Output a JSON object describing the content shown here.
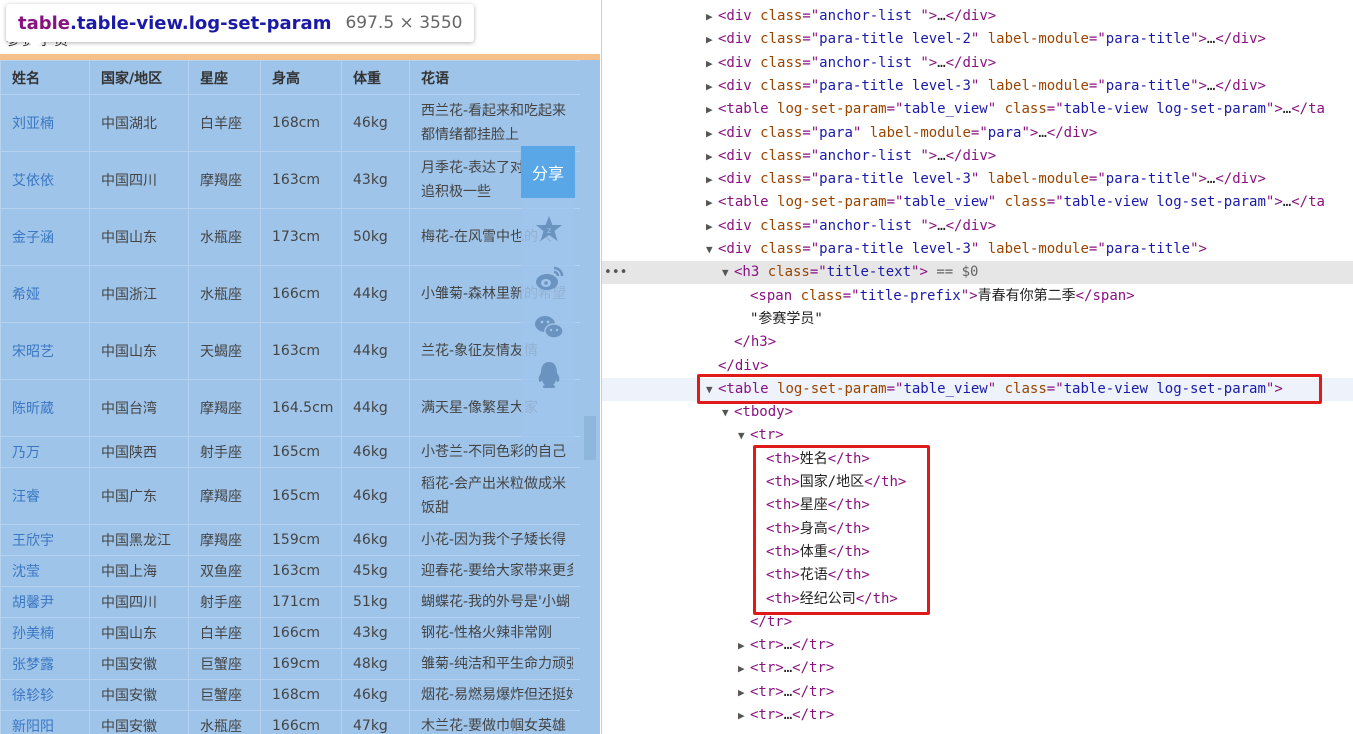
{
  "tooltip": {
    "tag": "table",
    "classes": ".table-view.log-set-param",
    "dimensions": "697.5 × 3550"
  },
  "page_ghost_text": "参赛学员",
  "table": {
    "headers": [
      "姓名",
      "国家/地区",
      "星座",
      "身高",
      "体重",
      "花语"
    ],
    "rows": [
      {
        "name": "刘亚楠",
        "region": "中国湖北",
        "sign": "白羊座",
        "height": "168cm",
        "weight": "46kg",
        "flower": "西兰花-看起来和吃起来都情绪都挂脸上",
        "tall": true
      },
      {
        "name": "艾依依",
        "region": "中国四川",
        "sign": "摩羯座",
        "height": "163cm",
        "weight": "43kg",
        "flower": "月季花-表达了对幸福的追积极一些",
        "tall": true
      },
      {
        "name": "金子涵",
        "region": "中国山东",
        "sign": "水瓶座",
        "height": "173cm",
        "weight": "50kg",
        "flower": "梅花-在风雪中也的人",
        "tall": true
      },
      {
        "name": "希娅",
        "region": "中国浙江",
        "sign": "水瓶座",
        "height": "166cm",
        "weight": "44kg",
        "flower": "小雏菊-森林里新的希望",
        "tall": true
      },
      {
        "name": "宋昭艺",
        "region": "中国山东",
        "sign": "天蝎座",
        "height": "163cm",
        "weight": "44kg",
        "flower": "兰花-象征友情友情",
        "tall": true
      },
      {
        "name": "陈昕葳",
        "region": "中国台湾",
        "sign": "摩羯座",
        "height": "164.5cm",
        "weight": "44kg",
        "flower": "满天星-像繁星大家",
        "tall": true
      },
      {
        "name": "乃万",
        "region": "中国陕西",
        "sign": "射手座",
        "height": "165cm",
        "weight": "46kg",
        "flower": "小苍兰-不同色彩的自己",
        "tall": false
      },
      {
        "name": "汪睿",
        "region": "中国广东",
        "sign": "摩羯座",
        "height": "165cm",
        "weight": "46kg",
        "flower": "稻花-会产出米粒做成米饭甜",
        "tall": true
      },
      {
        "name": "王欣宇",
        "region": "中国黑龙江",
        "sign": "摩羯座",
        "height": "159cm",
        "weight": "46kg",
        "flower": "小花-因为我个子矮长得",
        "tall": false
      },
      {
        "name": "沈莹",
        "region": "中国上海",
        "sign": "双鱼座",
        "height": "163cm",
        "weight": "45kg",
        "flower": "迎春花-要给大家带来更多",
        "tall": false
      },
      {
        "name": "胡馨尹",
        "region": "中国四川",
        "sign": "射手座",
        "height": "171cm",
        "weight": "51kg",
        "flower": "蝴蝶花-我的外号是'小蝴",
        "tall": false
      },
      {
        "name": "孙美楠",
        "region": "中国山东",
        "sign": "白羊座",
        "height": "166cm",
        "weight": "43kg",
        "flower": "钢花-性格火辣非常刚",
        "tall": false
      },
      {
        "name": "张梦露",
        "region": "中国安徽",
        "sign": "巨蟹座",
        "height": "169cm",
        "weight": "48kg",
        "flower": "雏菊-纯洁和平生命力顽强",
        "tall": false
      },
      {
        "name": "徐轸轸",
        "region": "中国安徽",
        "sign": "巨蟹座",
        "height": "168cm",
        "weight": "46kg",
        "flower": "烟花-易燃易爆炸但还挺好",
        "tall": false
      },
      {
        "name": "新阳阳",
        "region": "中国安徽",
        "sign": "水瓶座",
        "height": "166cm",
        "weight": "47kg",
        "flower": "木兰花-要做巾帼女英雄",
        "tall": false
      }
    ]
  },
  "share": {
    "label": "分享",
    "icons": [
      "star-icon",
      "weibo-icon",
      "wechat-icon",
      "qq-icon"
    ]
  },
  "devtools": {
    "lines": [
      {
        "indent": 0,
        "tri": "▶",
        "html": [
          [
            "t",
            "<div "
          ],
          [
            "an",
            "class"
          ],
          [
            "t",
            "=\""
          ],
          [
            "av",
            "anchor-list "
          ],
          [
            "t",
            "\">"
          ],
          [
            "tx",
            "…"
          ],
          [
            "t",
            "</div>"
          ]
        ]
      },
      {
        "indent": 0,
        "tri": "▶",
        "html": [
          [
            "t",
            "<div "
          ],
          [
            "an",
            "class"
          ],
          [
            "t",
            "=\""
          ],
          [
            "av",
            "para-title level-2"
          ],
          [
            "t",
            "\" "
          ],
          [
            "an",
            "label-module"
          ],
          [
            "t",
            "=\""
          ],
          [
            "av",
            "para-title"
          ],
          [
            "t",
            "\">"
          ],
          [
            "tx",
            "…"
          ],
          [
            "t",
            "</div>"
          ]
        ]
      },
      {
        "indent": 0,
        "tri": "▶",
        "html": [
          [
            "t",
            "<div "
          ],
          [
            "an",
            "class"
          ],
          [
            "t",
            "=\""
          ],
          [
            "av",
            "anchor-list "
          ],
          [
            "t",
            "\">"
          ],
          [
            "tx",
            "…"
          ],
          [
            "t",
            "</div>"
          ]
        ]
      },
      {
        "indent": 0,
        "tri": "▶",
        "html": [
          [
            "t",
            "<div "
          ],
          [
            "an",
            "class"
          ],
          [
            "t",
            "=\""
          ],
          [
            "av",
            "para-title level-3"
          ],
          [
            "t",
            "\" "
          ],
          [
            "an",
            "label-module"
          ],
          [
            "t",
            "=\""
          ],
          [
            "av",
            "para-title"
          ],
          [
            "t",
            "\">"
          ],
          [
            "tx",
            "…"
          ],
          [
            "t",
            "</div>"
          ]
        ]
      },
      {
        "indent": 0,
        "tri": "▶",
        "html": [
          [
            "t",
            "<table "
          ],
          [
            "an",
            "log-set-param"
          ],
          [
            "t",
            "=\""
          ],
          [
            "av",
            "table_view"
          ],
          [
            "t",
            "\" "
          ],
          [
            "an",
            "class"
          ],
          [
            "t",
            "=\""
          ],
          [
            "av",
            "table-view log-set-param"
          ],
          [
            "t",
            "\">"
          ],
          [
            "tx",
            "…"
          ],
          [
            "t",
            "</ta"
          ]
        ]
      },
      {
        "indent": 0,
        "tri": "▶",
        "html": [
          [
            "t",
            "<div "
          ],
          [
            "an",
            "class"
          ],
          [
            "t",
            "=\""
          ],
          [
            "av",
            "para"
          ],
          [
            "t",
            "\" "
          ],
          [
            "an",
            "label-module"
          ],
          [
            "t",
            "=\""
          ],
          [
            "av",
            "para"
          ],
          [
            "t",
            "\">"
          ],
          [
            "tx",
            "…"
          ],
          [
            "t",
            "</div>"
          ]
        ]
      },
      {
        "indent": 0,
        "tri": "▶",
        "html": [
          [
            "t",
            "<div "
          ],
          [
            "an",
            "class"
          ],
          [
            "t",
            "=\""
          ],
          [
            "av",
            "anchor-list "
          ],
          [
            "t",
            "\">"
          ],
          [
            "tx",
            "…"
          ],
          [
            "t",
            "</div>"
          ]
        ]
      },
      {
        "indent": 0,
        "tri": "▶",
        "html": [
          [
            "t",
            "<div "
          ],
          [
            "an",
            "class"
          ],
          [
            "t",
            "=\""
          ],
          [
            "av",
            "para-title level-3"
          ],
          [
            "t",
            "\" "
          ],
          [
            "an",
            "label-module"
          ],
          [
            "t",
            "=\""
          ],
          [
            "av",
            "para-title"
          ],
          [
            "t",
            "\">"
          ],
          [
            "tx",
            "…"
          ],
          [
            "t",
            "</div>"
          ]
        ]
      },
      {
        "indent": 0,
        "tri": "▶",
        "html": [
          [
            "t",
            "<table "
          ],
          [
            "an",
            "log-set-param"
          ],
          [
            "t",
            "=\""
          ],
          [
            "av",
            "table_view"
          ],
          [
            "t",
            "\" "
          ],
          [
            "an",
            "class"
          ],
          [
            "t",
            "=\""
          ],
          [
            "av",
            "table-view log-set-param"
          ],
          [
            "t",
            "\">"
          ],
          [
            "tx",
            "…"
          ],
          [
            "t",
            "</ta"
          ]
        ]
      },
      {
        "indent": 0,
        "tri": "▶",
        "html": [
          [
            "t",
            "<div "
          ],
          [
            "an",
            "class"
          ],
          [
            "t",
            "=\""
          ],
          [
            "av",
            "anchor-list "
          ],
          [
            "t",
            "\">"
          ],
          [
            "tx",
            "…"
          ],
          [
            "t",
            "</div>"
          ]
        ]
      },
      {
        "indent": 0,
        "tri": "▼",
        "html": [
          [
            "t",
            "<div "
          ],
          [
            "an",
            "class"
          ],
          [
            "t",
            "=\""
          ],
          [
            "av",
            "para-title level-3"
          ],
          [
            "t",
            "\" "
          ],
          [
            "an",
            "label-module"
          ],
          [
            "t",
            "=\""
          ],
          [
            "av",
            "para-title"
          ],
          [
            "t",
            "\">"
          ]
        ]
      },
      {
        "indent": 1,
        "tri": "▼",
        "sel": true,
        "html": [
          [
            "t",
            "<h3 "
          ],
          [
            "an",
            "class"
          ],
          [
            "t",
            "=\""
          ],
          [
            "av",
            "title-text"
          ],
          [
            "t",
            "\">"
          ],
          [
            "cm",
            " == $0"
          ]
        ]
      },
      {
        "indent": 2,
        "tri": "",
        "html": [
          [
            "t",
            "<span "
          ],
          [
            "an",
            "class"
          ],
          [
            "t",
            "=\""
          ],
          [
            "av",
            "title-prefix"
          ],
          [
            "t",
            "\">"
          ],
          [
            "tx",
            "青春有你第二季"
          ],
          [
            "t",
            "</span>"
          ]
        ]
      },
      {
        "indent": 2,
        "tri": "",
        "html": [
          [
            "tx",
            "\"参赛学员\""
          ]
        ]
      },
      {
        "indent": 1,
        "tri": "",
        "html": [
          [
            "t",
            "</h3>"
          ]
        ]
      },
      {
        "indent": 0,
        "tri": "",
        "html": [
          [
            "t",
            "</div>"
          ]
        ]
      },
      {
        "indent": 0,
        "tri": "▼",
        "hover": true,
        "html": [
          [
            "t",
            "<table "
          ],
          [
            "an",
            "log-set-param"
          ],
          [
            "t",
            "=\""
          ],
          [
            "av",
            "table_view"
          ],
          [
            "t",
            "\" "
          ],
          [
            "an",
            "class"
          ],
          [
            "t",
            "=\""
          ],
          [
            "av",
            "table-view log-set-param"
          ],
          [
            "t",
            "\">"
          ]
        ]
      },
      {
        "indent": 1,
        "tri": "▼",
        "html": [
          [
            "t",
            "<tbody>"
          ]
        ]
      },
      {
        "indent": 2,
        "tri": "▼",
        "html": [
          [
            "t",
            "<tr>"
          ]
        ]
      },
      {
        "indent": 3,
        "tri": "",
        "html": [
          [
            "t",
            "<th>"
          ],
          [
            "tx",
            "姓名"
          ],
          [
            "t",
            "</th>"
          ]
        ]
      },
      {
        "indent": 3,
        "tri": "",
        "html": [
          [
            "t",
            "<th>"
          ],
          [
            "tx",
            "国家/地区"
          ],
          [
            "t",
            "</th>"
          ]
        ]
      },
      {
        "indent": 3,
        "tri": "",
        "html": [
          [
            "t",
            "<th>"
          ],
          [
            "tx",
            "星座"
          ],
          [
            "t",
            "</th>"
          ]
        ]
      },
      {
        "indent": 3,
        "tri": "",
        "html": [
          [
            "t",
            "<th>"
          ],
          [
            "tx",
            "身高"
          ],
          [
            "t",
            "</th>"
          ]
        ]
      },
      {
        "indent": 3,
        "tri": "",
        "html": [
          [
            "t",
            "<th>"
          ],
          [
            "tx",
            "体重"
          ],
          [
            "t",
            "</th>"
          ]
        ]
      },
      {
        "indent": 3,
        "tri": "",
        "html": [
          [
            "t",
            "<th>"
          ],
          [
            "tx",
            "花语"
          ],
          [
            "t",
            "</th>"
          ]
        ]
      },
      {
        "indent": 3,
        "tri": "",
        "html": [
          [
            "t",
            "<th>"
          ],
          [
            "tx",
            "经纪公司"
          ],
          [
            "t",
            "</th>"
          ]
        ]
      },
      {
        "indent": 2,
        "tri": "",
        "html": [
          [
            "t",
            "</tr>"
          ]
        ]
      },
      {
        "indent": 2,
        "tri": "▶",
        "html": [
          [
            "t",
            "<tr>"
          ],
          [
            "tx",
            "…"
          ],
          [
            "t",
            "</tr>"
          ]
        ]
      },
      {
        "indent": 2,
        "tri": "▶",
        "html": [
          [
            "t",
            "<tr>"
          ],
          [
            "tx",
            "…"
          ],
          [
            "t",
            "</tr>"
          ]
        ]
      },
      {
        "indent": 2,
        "tri": "▶",
        "html": [
          [
            "t",
            "<tr>"
          ],
          [
            "tx",
            "…"
          ],
          [
            "t",
            "</tr>"
          ]
        ]
      },
      {
        "indent": 2,
        "tri": "▶",
        "html": [
          [
            "t",
            "<tr>"
          ],
          [
            "tx",
            "…"
          ],
          [
            "t",
            "</tr>"
          ]
        ]
      }
    ]
  },
  "colors": {
    "highlight_box": "#e0191b",
    "table_overlay": "#9fc4ea",
    "tag": "#881280",
    "attr_name": "#994500",
    "attr_value": "#1a1aa6"
  }
}
